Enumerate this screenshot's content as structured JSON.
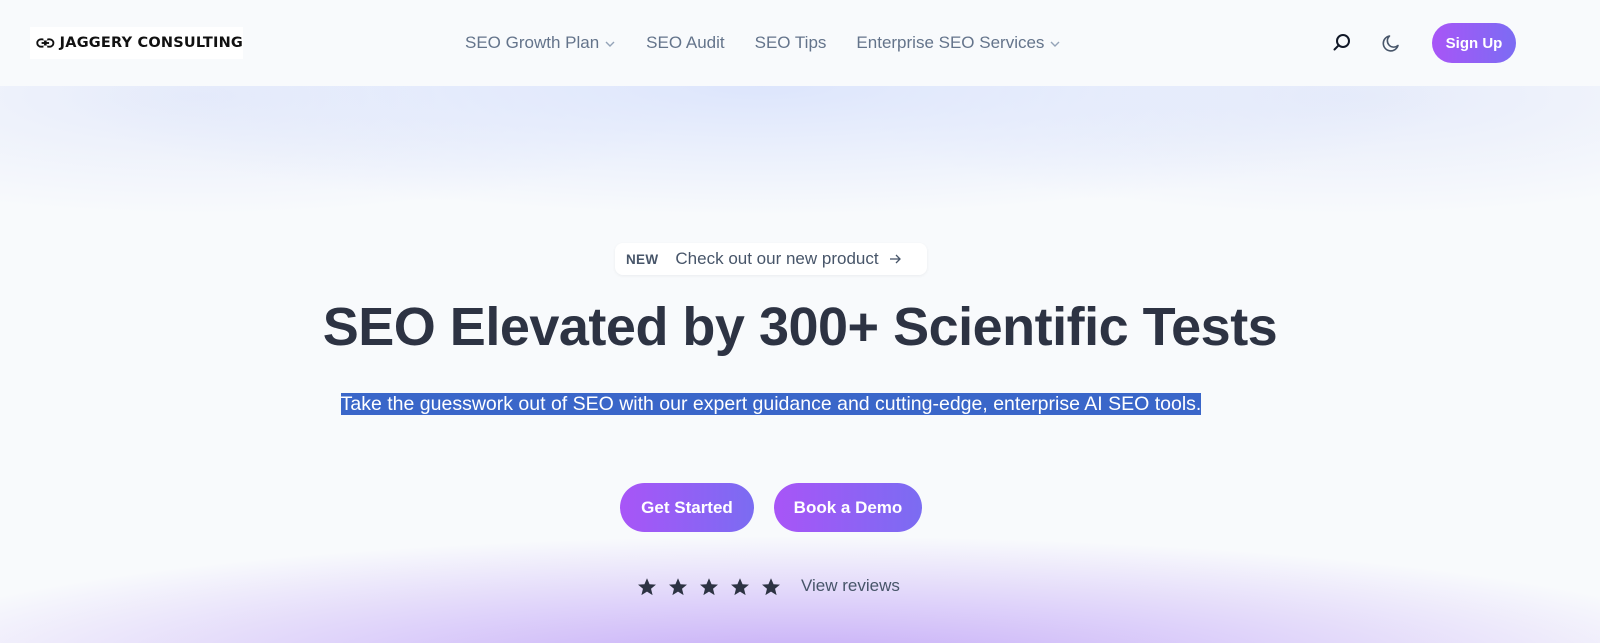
{
  "brand": {
    "name": "JAGGERY CONSULTING",
    "logo_icon": "link-icon"
  },
  "nav": {
    "items": [
      {
        "label": "SEO Growth Plan",
        "has_dropdown": true
      },
      {
        "label": "SEO Audit",
        "has_dropdown": false
      },
      {
        "label": "SEO Tips",
        "has_dropdown": false
      },
      {
        "label": "Enterprise SEO Services",
        "has_dropdown": true
      }
    ],
    "search_icon": "search-icon",
    "theme_icon": "moon-icon",
    "signup_label": "Sign Up"
  },
  "hero": {
    "badge_tag": "NEW",
    "badge_text": "Check out our new product",
    "badge_icon": "arrow-right-icon",
    "title": "SEO Elevated by 300+ Scientific Tests",
    "subtitle": "Take the guesswork out of SEO with our expert guidance and cutting-edge, enterprise AI SEO tools.",
    "primary_cta": "Get Started",
    "secondary_cta": "Book a Demo",
    "rating_stars": 5,
    "reviews_link": "View reviews"
  },
  "colors": {
    "accent_start": "#a855f7",
    "accent_end": "#7c6cf3",
    "text_selection": "#3a66c9",
    "heading": "#2d3343"
  }
}
